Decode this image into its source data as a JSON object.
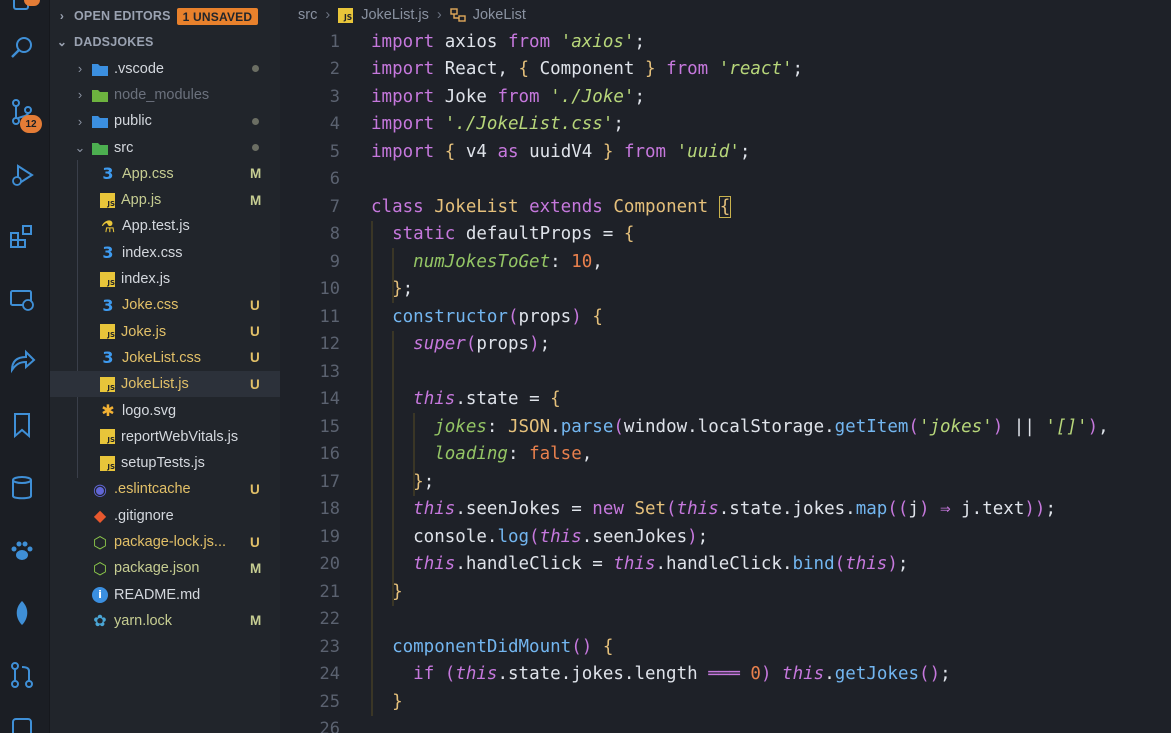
{
  "explorer": {
    "open_editors_label": "OPEN EDITORS",
    "unsaved_badge": "1 UNSAVED",
    "project_label": "DADSJOKES",
    "items": [
      {
        "name": ".vscode",
        "kind": "folder-vscode",
        "status": "dot",
        "color": "#d4d8de"
      },
      {
        "name": "node_modules",
        "kind": "folder-node",
        "status": "",
        "color": "#6b717d"
      },
      {
        "name": "public",
        "kind": "folder-public",
        "status": "dot",
        "color": "#d4d8de"
      },
      {
        "name": "src",
        "kind": "folder-src",
        "status": "dot",
        "color": "#d4d8de"
      },
      {
        "name": "App.css",
        "kind": "css",
        "status": "M",
        "color": "#c6cd92"
      },
      {
        "name": "App.js",
        "kind": "js",
        "status": "M",
        "color": "#c6cd92"
      },
      {
        "name": "App.test.js",
        "kind": "test",
        "status": "",
        "color": "#d4d8de"
      },
      {
        "name": "index.css",
        "kind": "css",
        "status": "",
        "color": "#d4d8de"
      },
      {
        "name": "index.js",
        "kind": "js",
        "status": "",
        "color": "#d4d8de"
      },
      {
        "name": "Joke.css",
        "kind": "css",
        "status": "U",
        "color": "#e2c068"
      },
      {
        "name": "Joke.js",
        "kind": "js",
        "status": "U",
        "color": "#e2c068"
      },
      {
        "name": "JokeList.css",
        "kind": "css",
        "status": "U",
        "color": "#e2c068"
      },
      {
        "name": "JokeList.js",
        "kind": "js",
        "status": "U",
        "color": "#e2c068"
      },
      {
        "name": "logo.svg",
        "kind": "svg",
        "status": "",
        "color": "#d4d8de"
      },
      {
        "name": "reportWebVitals.js",
        "kind": "js",
        "status": "",
        "color": "#d4d8de"
      },
      {
        "name": "setupTests.js",
        "kind": "js",
        "status": "",
        "color": "#d4d8de"
      },
      {
        "name": ".eslintcache",
        "kind": "eslint",
        "status": "U",
        "color": "#e2c068"
      },
      {
        "name": ".gitignore",
        "kind": "git",
        "status": "",
        "color": "#d4d8de"
      },
      {
        "name": "package-lock.js...",
        "kind": "node",
        "status": "U",
        "color": "#e2c068"
      },
      {
        "name": "package.json",
        "kind": "node",
        "status": "M",
        "color": "#c6cd92"
      },
      {
        "name": "README.md",
        "kind": "info",
        "status": "",
        "color": "#d4d8de"
      },
      {
        "name": "yarn.lock",
        "kind": "yarn",
        "status": "M",
        "color": "#c6cd92"
      }
    ]
  },
  "activity": {
    "scm_badge": "12",
    "icons": [
      "explorer-icon",
      "search-icon",
      "source-control-icon",
      "run-debug-icon",
      "extensions-icon",
      "remote-explorer-icon",
      "live-share-icon",
      "bookmarks-icon",
      "database-icon",
      "paw-icon",
      "mongodb-leaf-icon",
      "pull-request-icon"
    ]
  },
  "breadcrumb": {
    "folder": "src",
    "file": "JokeList.js",
    "symbol": "JokeList"
  },
  "code": {
    "line_numbers": [
      "1",
      "2",
      "3",
      "4",
      "5",
      "6",
      "7",
      "8",
      "9",
      "10",
      "11",
      "12",
      "13",
      "14",
      "15",
      "16",
      "17",
      "18",
      "19",
      "20",
      "21",
      "22",
      "23",
      "24",
      "25",
      "26"
    ],
    "lines": [
      "import axios from 'axios';",
      "import React, { Component } from 'react';",
      "import Joke from './Joke';",
      "import './JokeList.css';",
      "import { v4 as uuidV4 } from 'uuid';",
      "",
      "class JokeList extends Component {",
      "  static defaultProps = {",
      "    numJokesToGet: 10,",
      "  };",
      "  constructor(props) {",
      "    super(props);",
      "",
      "    this.state = {",
      "      jokes: JSON.parse(window.localStorage.getItem('jokes') || '[]'),",
      "      loading: false,",
      "    };",
      "    this.seenJokes = new Set(this.state.jokes.map((j) ⇒ j.text));",
      "    console.log(this.seenJokes);",
      "    this.handleClick = this.handleClick.bind(this);",
      "  }",
      "",
      "  componentDidMount() {",
      "    if (this.state.jokes.length ═══ 0) this.getJokes();",
      "  }",
      ""
    ]
  }
}
